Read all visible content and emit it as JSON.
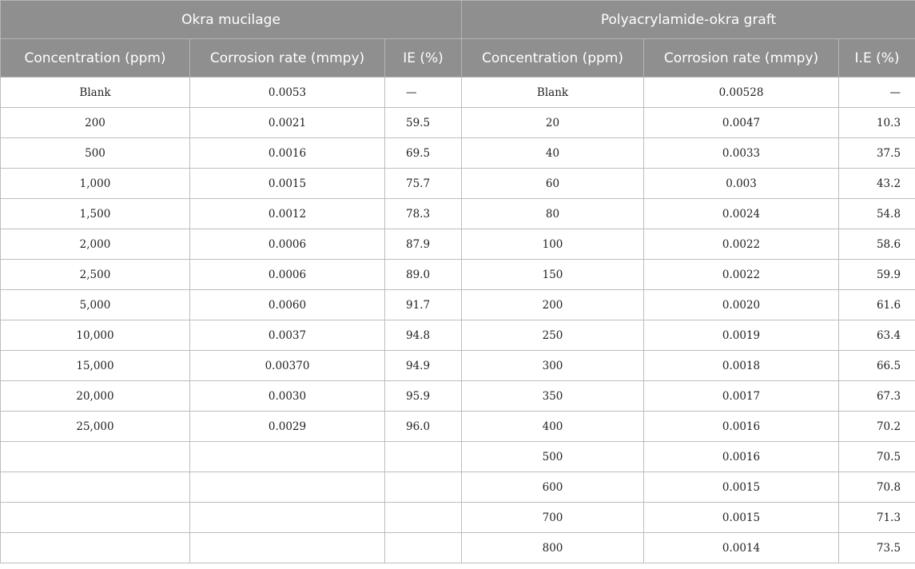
{
  "groups": [
    "Okra mucilage",
    "Polyacrylamide-okra graft"
  ],
  "columns": [
    "Concentration (ppm)",
    "Corrosion rate (mmpy)",
    "IE (%)",
    "Concentration (ppm)",
    "Corrosion rate (mmpy)",
    "I.E (%)"
  ],
  "rows": [
    [
      "Blank",
      "0.0053",
      "—",
      "Blank",
      "0.00528",
      "—"
    ],
    [
      "200",
      "0.0021",
      "59.5",
      "20",
      "0.0047",
      "10.3"
    ],
    [
      "500",
      "0.0016",
      "69.5",
      "40",
      "0.0033",
      "37.5"
    ],
    [
      "1,000",
      "0.0015",
      "75.7",
      "60",
      "0.003",
      "43.2"
    ],
    [
      "1,500",
      "0.0012",
      "78.3",
      "80",
      "0.0024",
      "54.8"
    ],
    [
      "2,000",
      "0.0006",
      "87.9",
      "100",
      "0.0022",
      "58.6"
    ],
    [
      "2,500",
      "0.0006",
      "89.0",
      "150",
      "0.0022",
      "59.9"
    ],
    [
      "5,000",
      "0.0060",
      "91.7",
      "200",
      "0.0020",
      "61.6"
    ],
    [
      "10,000",
      "0.0037",
      "94.8",
      "250",
      "0.0019",
      "63.4"
    ],
    [
      "15,000",
      "0.00370",
      "94.9",
      "300",
      "0.0018",
      "66.5"
    ],
    [
      "20,000",
      "0.0030",
      "95.9",
      "350",
      "0.0017",
      "67.3"
    ],
    [
      "25,000",
      "0.0029",
      "96.0",
      "400",
      "0.0016",
      "70.2"
    ],
    [
      "",
      "",
      "",
      "500",
      "0.0016",
      "70.5"
    ],
    [
      "",
      "",
      "",
      "600",
      "0.0015",
      "70.8"
    ],
    [
      "",
      "",
      "",
      "700",
      "0.0015",
      "71.3"
    ],
    [
      "",
      "",
      "",
      "800",
      "0.0014",
      "73.5"
    ]
  ]
}
